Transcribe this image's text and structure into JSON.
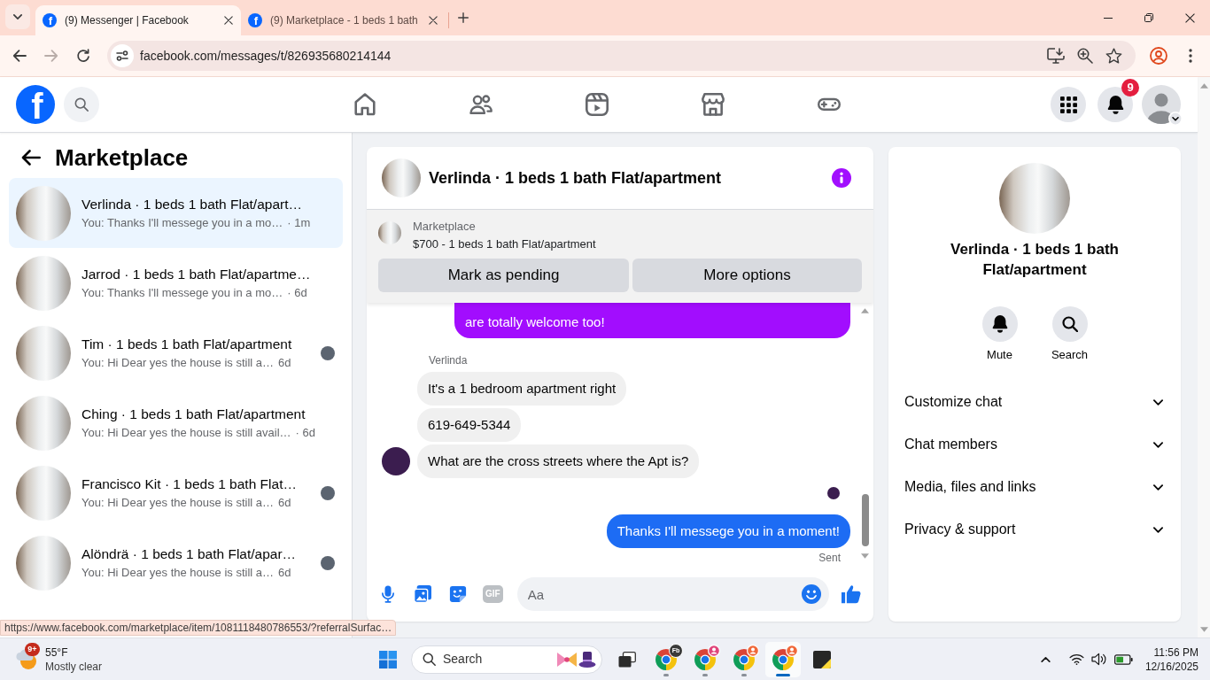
{
  "browser": {
    "tabs": [
      {
        "favicon": "f",
        "title": "(9) Messenger | Facebook",
        "selected": true
      },
      {
        "favicon": "f",
        "title": "(9) Marketplace - 1 beds 1 bath",
        "selected": false
      }
    ],
    "forward_disabled": true,
    "address": "facebook.com/messages/t/826935680214144",
    "status_url": "https://www.facebook.com/marketplace/item/1081118480786553/?referralSurfac…"
  },
  "header": {
    "logo": "f",
    "notifications_badge": "9"
  },
  "sidebar": {
    "title": "Marketplace",
    "conversations": [
      {
        "title": "Verlinda · 1 beds 1 bath Flat/apart…",
        "preview": "You: Thanks I'll messege you in a mo…",
        "time": "· 1m",
        "selected": true,
        "seen": false
      },
      {
        "title": "Jarrod · 1 beds 1 bath Flat/apartme…",
        "preview": "You: Thanks I'll messege you in a mo…",
        "time": "· 6d",
        "selected": false,
        "seen": false
      },
      {
        "title": "Tim · 1 beds 1 bath Flat/apartment",
        "preview": "You: Hi Dear yes the house is still a…",
        "time": "6d",
        "selected": false,
        "seen": true
      },
      {
        "title": "Ching · 1 beds 1 bath Flat/apartment",
        "preview": "You: Hi Dear yes the house is still avail…",
        "time": "· 6d",
        "selected": false,
        "seen": false
      },
      {
        "title": "Francisco Kit · 1 beds 1 bath Flat…",
        "preview": "You: Hi Dear yes the house is still a…",
        "time": "6d",
        "selected": false,
        "seen": true
      },
      {
        "title": "Alöndrä · 1 beds 1 bath Flat/apar…",
        "preview": "You: Hi Dear yes the house is still a…",
        "time": "6d",
        "selected": false,
        "seen": true
      }
    ]
  },
  "chat": {
    "title": "Verlinda · 1 beds 1 bath Flat/apartment",
    "listing": {
      "label": "Marketplace",
      "summary": "$700 - 1 beds 1 bath Flat/apartment",
      "actions": [
        "Mark as pending",
        "More options"
      ]
    },
    "messages": [
      {
        "kind": "outgoing",
        "text": "are totally welcome too!",
        "color": "#a20dfe"
      },
      {
        "kind": "sender",
        "text": "Verlinda"
      },
      {
        "kind": "incoming",
        "text": "It's a 1 bedroom apartment right",
        "avatar": false
      },
      {
        "kind": "incoming",
        "text": "619-649-5344",
        "avatar": false
      },
      {
        "kind": "incoming",
        "text": "What are the cross streets where the Apt is?",
        "avatar": true
      },
      {
        "kind": "seen"
      },
      {
        "kind": "outgoing",
        "text": "Thanks I'll messege you in a moment!",
        "color": "#1d6cf4"
      },
      {
        "kind": "status",
        "text": "Sent"
      }
    ],
    "composer": {
      "gif_label": "GIF",
      "placeholder": "Aa"
    }
  },
  "details": {
    "title": "Verlinda · 1 beds 1 bath Flat/apartment",
    "actions": [
      {
        "kind": "mute",
        "label": "Mute"
      },
      {
        "kind": "search",
        "label": "Search"
      }
    ],
    "sections": [
      {
        "label": "Customize chat",
        "expanded": false
      },
      {
        "label": "Chat members",
        "expanded": false
      },
      {
        "label": "Media, files and links",
        "expanded": false
      },
      {
        "label": "Privacy & support",
        "expanded": false
      }
    ]
  },
  "taskbar": {
    "weather": {
      "badge": "9+",
      "temperature": "55°F",
      "condition": "Mostly clear"
    },
    "search": {
      "placeholder": "Search"
    },
    "apps": [
      {
        "kind": "task_view",
        "selected": false,
        "running": false
      },
      {
        "kind": "browser",
        "badge": "Fb",
        "selected": false,
        "running": true
      },
      {
        "kind": "browser",
        "color": "#e0457b",
        "selected": false,
        "running": true
      },
      {
        "kind": "browser",
        "color": "#f0683a",
        "selected": false,
        "running": true
      },
      {
        "kind": "browser",
        "color": "#f0683a",
        "selected": true,
        "running": true
      },
      {
        "kind": "sticky_notes",
        "selected": false,
        "running": false
      }
    ],
    "clock": {
      "time": "11:56 PM",
      "date": "12/16/2025"
    }
  }
}
